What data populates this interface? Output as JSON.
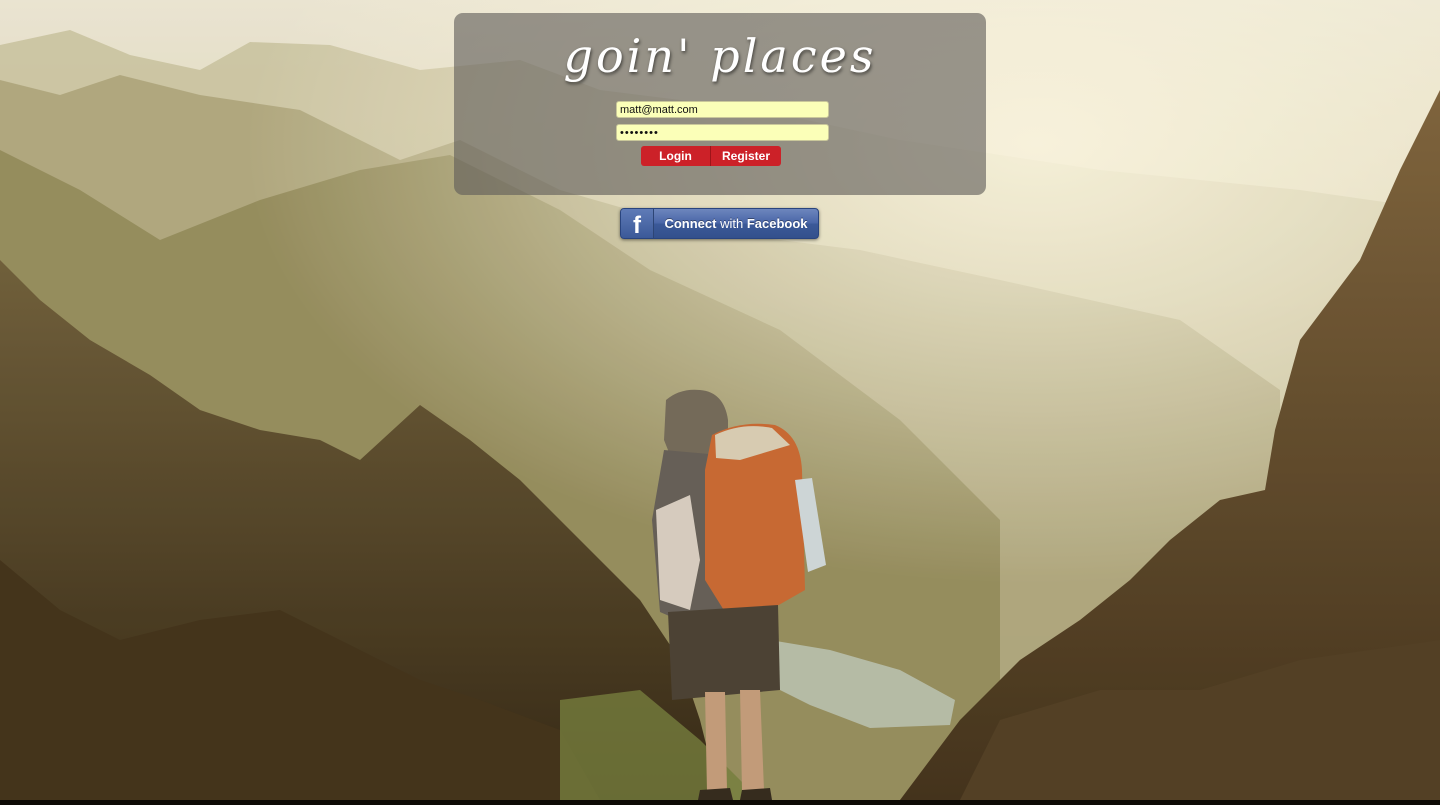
{
  "app": {
    "logo_text": "goin' places"
  },
  "login_form": {
    "email_value": "matt@matt.com",
    "password_value": "password",
    "login_label": "Login",
    "register_label": "Register"
  },
  "facebook": {
    "icon_glyph": "f",
    "connect_word": "Connect",
    "with_word": "with",
    "brand_word": "Facebook"
  },
  "colors": {
    "accent_red": "#cc2128",
    "field_background": "#fbffb8",
    "facebook_blue": "#3b5998",
    "panel_overlay": "rgba(95,92,88,0.62)"
  },
  "background": {
    "icon": "mountain-hiker-photo"
  }
}
